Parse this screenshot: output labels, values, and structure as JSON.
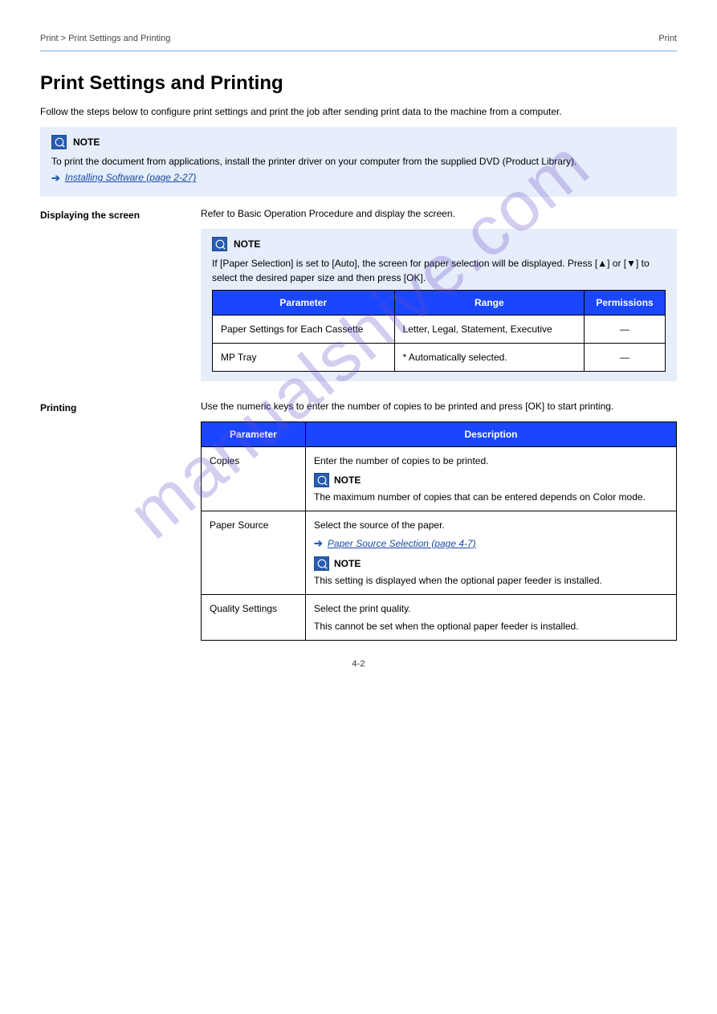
{
  "header": {
    "left": "Print > Print Settings and Printing",
    "right": "Print"
  },
  "title": "Print Settings and Printing",
  "intro": "Follow the steps below to configure print settings and print the job after sending print data to the machine from a computer.",
  "note1": {
    "label": "NOTE",
    "text": "To print the document from applications, install the printer driver on your computer from the supplied DVD (Product Library).",
    "link": "Installing Software (page 2-27)"
  },
  "section1": {
    "label": "Displaying the screen",
    "text": "Refer to Basic Operation Procedure and display the screen.",
    "note_label": "NOTE",
    "note_text": "If [Paper Selection] is set to [Auto], the screen for paper selection will be displayed. Press [▲] or [▼] to select the desired paper size and then press [OK].",
    "table": {
      "headers": [
        "Parameter",
        "Range",
        "Permissions"
      ],
      "rows": [
        [
          "Paper Settings for Each Cassette",
          "Letter, Legal, Statement, Executive",
          "—"
        ],
        [
          "MP Tray",
          "* Automatically selected.",
          "—"
        ]
      ]
    }
  },
  "section2": {
    "label": "Printing",
    "text": "Use the numeric keys to enter the number of copies to be printed and press [OK] to start printing.",
    "table": {
      "headers": [
        "Parameter",
        "Description"
      ],
      "rows": [
        {
          "c0": "Copies",
          "c1_lines": [
            "Enter the number of copies to be printed.",
            "The maximum number of copies that can be entered depends on Color mode."
          ],
          "note_label": "NOTE"
        },
        {
          "c0": "Paper Source",
          "c1_line": "Select the source of the paper.",
          "link": "Paper Source Selection (page 4-7)",
          "note_label": "NOTE",
          "note_text": "This setting is displayed when the optional paper feeder is installed."
        },
        {
          "c0": "Quality Settings",
          "c1_lines": [
            "Select the print quality.",
            "This cannot be set when the optional paper feeder is installed."
          ]
        }
      ]
    }
  },
  "footer": "4-2"
}
